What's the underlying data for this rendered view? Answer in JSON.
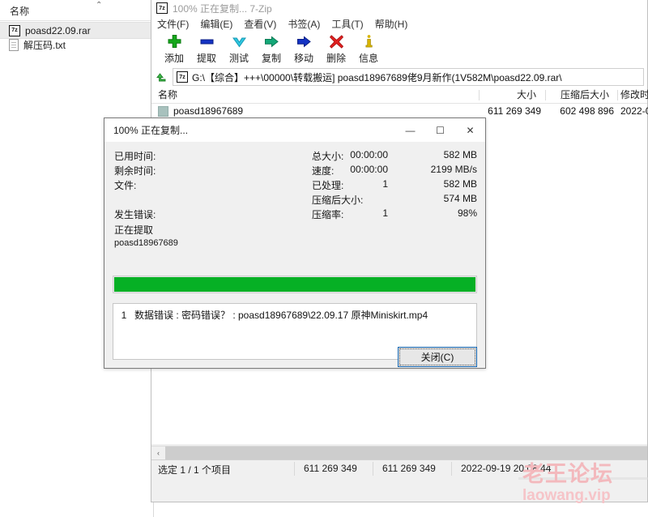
{
  "explorer": {
    "column_header": "名称",
    "sort_caret": "⌃",
    "files": [
      {
        "name": "poasd22.09.rar",
        "icon": "archive-7z-icon",
        "selected": true
      },
      {
        "name": "解压码.txt",
        "icon": "text-file-icon",
        "selected": false
      }
    ]
  },
  "sevenzip": {
    "title": "100% 正在复制... 7-Zip",
    "title_icon": "7z-app-icon",
    "menu": [
      {
        "label": "文件(F)",
        "name": "menu-file"
      },
      {
        "label": "编辑(E)",
        "name": "menu-edit"
      },
      {
        "label": "查看(V)",
        "name": "menu-view"
      },
      {
        "label": "书签(A)",
        "name": "menu-bookmarks"
      },
      {
        "label": "工具(T)",
        "name": "menu-tools"
      },
      {
        "label": "帮助(H)",
        "name": "menu-help"
      }
    ],
    "toolbar": [
      {
        "label": "添加",
        "icon": "plus-add-icon"
      },
      {
        "label": "提取",
        "icon": "minus-extract-icon"
      },
      {
        "label": "测试",
        "icon": "check-test-icon"
      },
      {
        "label": "复制",
        "icon": "arrow-copy-icon"
      },
      {
        "label": "移动",
        "icon": "arrow-move-icon"
      },
      {
        "label": "删除",
        "icon": "x-delete-icon"
      },
      {
        "label": "信息",
        "icon": "info-icon"
      }
    ],
    "address": {
      "up_icon": "up-folder-icon",
      "path_icon": "7z-archive-icon",
      "path": "G:\\【综合】+++\\00000\\转载搬运] poasd18967689佬9月新作(1V582M\\poasd22.09.rar\\"
    },
    "columns": [
      {
        "label": "名称",
        "align": "left"
      },
      {
        "label": "大小",
        "align": "right"
      },
      {
        "label": "压缩后大小",
        "align": "right"
      },
      {
        "label": "修改时间",
        "align": "left"
      }
    ],
    "rows": [
      {
        "name": "poasd18967689",
        "icon": "folder-icon",
        "size": "611 269 349",
        "packed_size": "602 498 896",
        "modified": "2022-0"
      }
    ],
    "scrollbar": {
      "left_arrow": "‹"
    },
    "statusbar": {
      "selection": "选定 1 / 1 个项目",
      "size": "611 269 349",
      "packed_size": "611 269 349",
      "modified": "2022-09-19 20:08:44"
    }
  },
  "dialog": {
    "title": "100% 正在复制...",
    "window_buttons": [
      {
        "glyph": "—",
        "name": "minimize-button"
      },
      {
        "glyph": "☐",
        "name": "maximize-button"
      },
      {
        "glyph": "✕",
        "name": "close-window-button"
      }
    ],
    "stats_left": [
      {
        "label": "已用时间:",
        "value": "00:00:00"
      },
      {
        "label": "剩余时间:",
        "value": "00:00:00"
      },
      {
        "label": "文件:",
        "value": "1"
      }
    ],
    "errors_label": "发生错误:",
    "errors_count": "1",
    "current_action": "正在提取",
    "current_file": "poasd18967689",
    "stats_right": [
      {
        "label": "总大小:",
        "value": "582 MB"
      },
      {
        "label": "速度:",
        "value": "2199 MB/s"
      },
      {
        "label": "已处理:",
        "value": "582 MB"
      },
      {
        "label": "压缩后大小:",
        "value": "574 MB"
      },
      {
        "label": "压缩率:",
        "value": "98%"
      }
    ],
    "progress": {
      "percent": 100,
      "color": "#06b025"
    },
    "error_list": [
      {
        "index": "1",
        "text": "数据错误 : 密码错误？ : poasd18967689\\22.09.17 原神Miniskirt.mp4"
      }
    ],
    "close_button": "关闭(C)"
  },
  "watermark": {
    "chinese": "老王论坛",
    "latin": "laowang.vip",
    "color": "#f3b9bd"
  }
}
